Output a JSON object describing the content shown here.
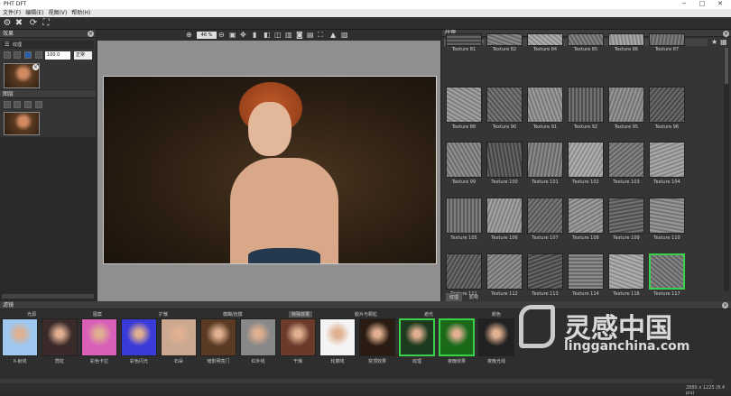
{
  "app": {
    "title": "PHT DFT"
  },
  "menu": [
    "文件(F)",
    "编辑(E)",
    "视图(V)",
    "帮助(H)"
  ],
  "zoom": "46 %",
  "layers_panel": {
    "title": "效果",
    "section": "纹理",
    "opacity": "100.0",
    "mode": "正常"
  },
  "mask_panel": {
    "title": "图层"
  },
  "texture_panel": {
    "title": "纹理",
    "category": "全部",
    "search_placeholder": "搜索",
    "rows": [
      [
        "Texture 81",
        "Texture 82",
        "Texture 84",
        "Texture 85",
        "Texture 86",
        "Texture 87"
      ],
      [
        "Texture 88",
        "Texture 90",
        "Texture 91",
        "Texture 92",
        "Texture 95",
        "Texture 96"
      ],
      [
        "Texture 99",
        "Texture 100",
        "Texture 101",
        "Texture 102",
        "Texture 103",
        "Texture 104"
      ],
      [
        "Texture 105",
        "Texture 106",
        "Texture 107",
        "Texture 108",
        "Texture 109",
        "Texture 110"
      ],
      [
        "Texture 111",
        "Texture 112",
        "Texture 113",
        "Texture 114",
        "Texture 116",
        "Texture 117"
      ]
    ],
    "tabs": [
      "纹理",
      "影响"
    ]
  },
  "effects": {
    "title": "滤镜",
    "categories": [
      "光源",
      "图案",
      "扩散",
      "模糊/抚摸",
      "特殊效果",
      "胶片与颗粒",
      "遮光",
      "颜色"
    ],
    "items": [
      "X-射线",
      "霓虹",
      "彩色卡拉",
      "彩色闪光",
      "石朵",
      "暗影明亮门",
      "红外线",
      "干燥",
      "轮廓线",
      "突顶效果",
      "纹理",
      "夜晚效果",
      "夜晚光线"
    ]
  },
  "status": "2880 x 1225 (8.4 pix)",
  "watermark": {
    "brand": "灵感中国",
    "url": "lingganchina.com"
  }
}
